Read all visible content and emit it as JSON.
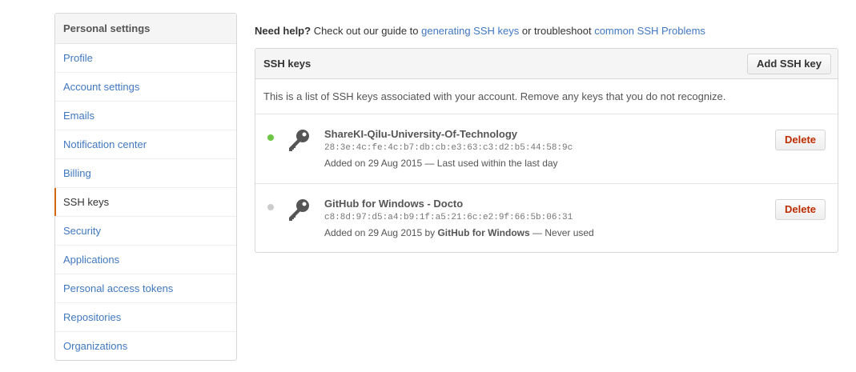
{
  "sidebar": {
    "header": "Personal settings",
    "items": [
      {
        "label": "Profile"
      },
      {
        "label": "Account settings"
      },
      {
        "label": "Emails"
      },
      {
        "label": "Notification center"
      },
      {
        "label": "Billing"
      },
      {
        "label": "SSH keys",
        "selected": true
      },
      {
        "label": "Security"
      },
      {
        "label": "Applications"
      },
      {
        "label": "Personal access tokens"
      },
      {
        "label": "Repositories"
      },
      {
        "label": "Organizations"
      }
    ]
  },
  "help": {
    "lead": "Need help?",
    "text1": " Check out our guide to ",
    "link1": "generating SSH keys",
    "text2": " or troubleshoot ",
    "link2": "common SSH Problems"
  },
  "panel": {
    "title": "SSH keys",
    "add_button": "Add SSH key",
    "description": "This is a list of SSH keys associated with your account. Remove any keys that you do not recognize.",
    "keys": [
      {
        "title": "ShareKI-Qilu-University-Of-Technology",
        "fingerprint": "28:3e:4c:fe:4c:b7:db:cb:e3:63:c3:d2:b5:44:58:9c",
        "added": "Added on 29 Aug 2015",
        "added_by": "",
        "usage": " — Last used within the last day",
        "status": "active",
        "status_color": "#6cc644",
        "delete_label": "Delete"
      },
      {
        "title": "GitHub for Windows - Docto",
        "fingerprint": "c8:8d:97:d5:a4:b9:1f:a5:21:6c:e2:9f:66:5b:06:31",
        "added": "Added on 29 Aug 2015 by ",
        "added_by": "GitHub for Windows",
        "usage": " — Never used",
        "status": "inactive",
        "status_color": "#cccccc",
        "delete_label": "Delete"
      }
    ]
  },
  "colors": {
    "link": "#4078c0",
    "selected_accent": "#d26911",
    "danger": "#bd2c00",
    "key_icon": "#555555"
  }
}
